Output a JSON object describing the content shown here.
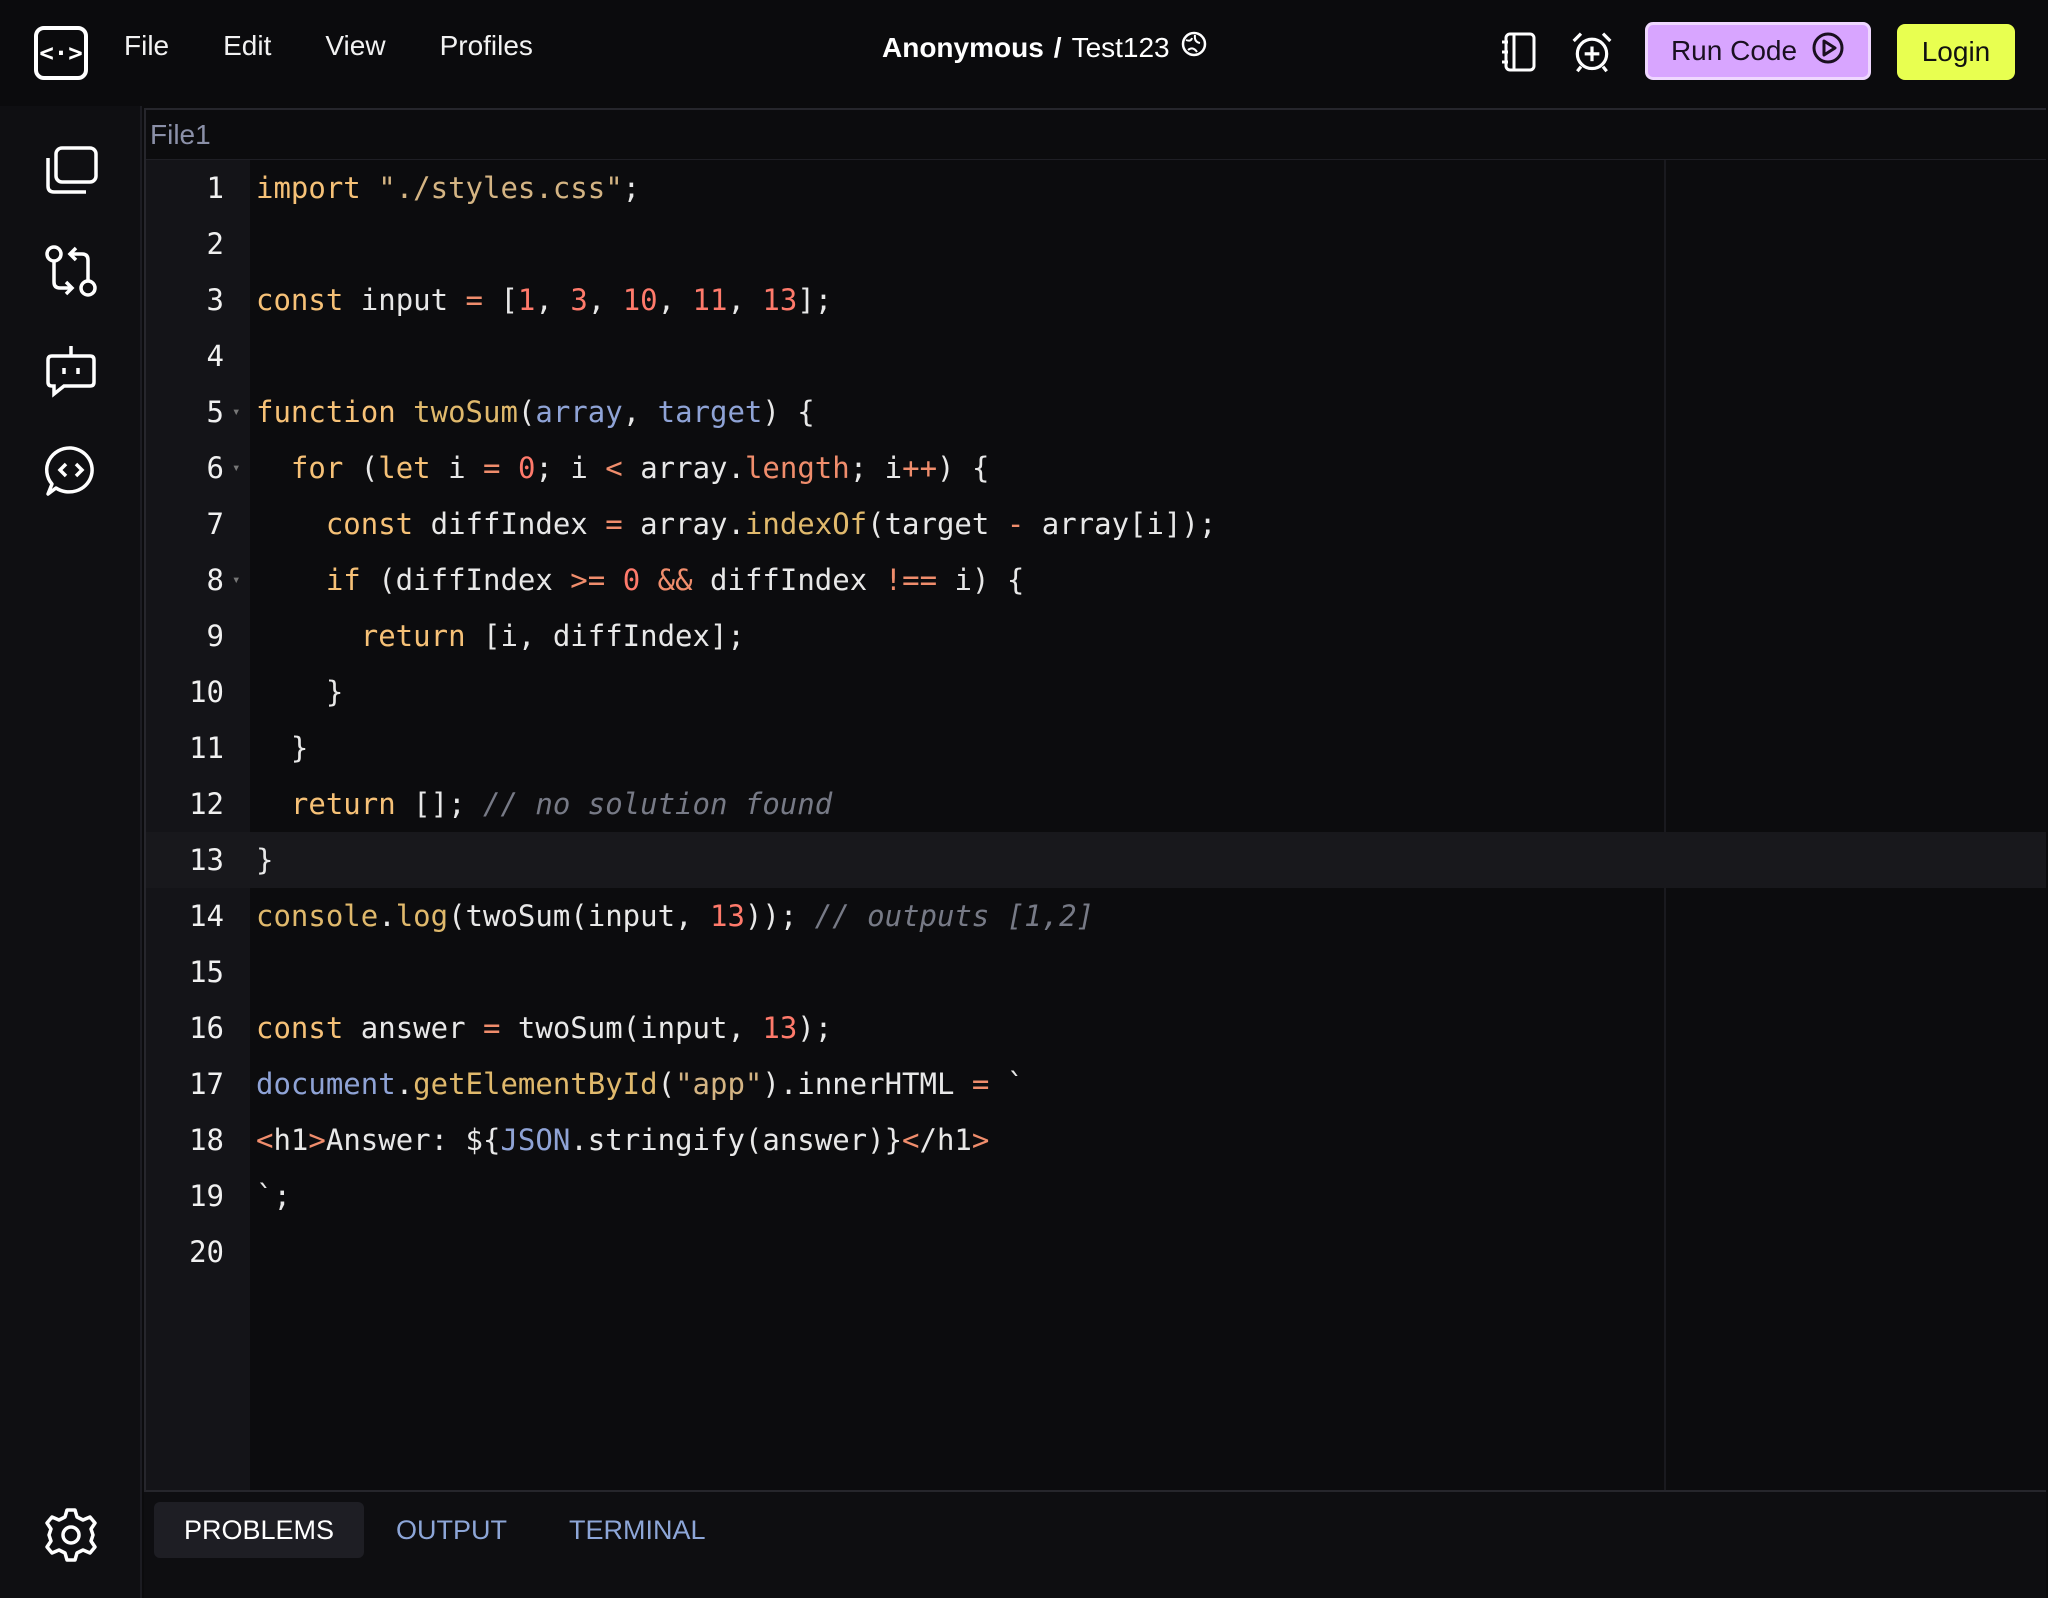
{
  "menu": {
    "logo": "<·>",
    "file": "File",
    "edit": "Edit",
    "view": "View",
    "profiles": "Profiles"
  },
  "project": {
    "owner": "Anonymous",
    "separator": "/",
    "name": "Test123"
  },
  "toolbar": {
    "run_label": "Run Code",
    "login_label": "Login"
  },
  "editor": {
    "file_tab": "File1",
    "current_line": 13,
    "lines": [
      "import \"./styles.css\";",
      "",
      "const input = [1, 3, 10, 11, 13];",
      "",
      "function twoSum(array, target) {",
      "  for (let i = 0; i < array.length; i++) {",
      "    const diffIndex = array.indexOf(target - array[i]);",
      "    if (diffIndex >= 0 && diffIndex !== i) {",
      "      return [i, diffIndex];",
      "    }",
      "  }",
      "  return []; // no solution found",
      "}",
      "console.log(twoSum(input, 13)); // outputs [1,2]",
      "",
      "const answer = twoSum(input, 13);",
      "document.getElementById(\"app\").innerHTML = `",
      "<h1>Answer: ${JSON.stringify(answer)}</h1>",
      "`;",
      ""
    ],
    "line_numbers": [
      "1",
      "2",
      "3",
      "4",
      "5",
      "6",
      "7",
      "8",
      "9",
      "10",
      "11",
      "12",
      "13",
      "14",
      "15",
      "16",
      "17",
      "18",
      "19",
      "20"
    ]
  },
  "panel": {
    "tabs": [
      "PROBLEMS",
      "OUTPUT",
      "TERMINAL"
    ],
    "active_tab": "PROBLEMS"
  },
  "colors": {
    "run_button": "#d8a5ff",
    "login_button": "#e8ff50",
    "background": "#0b0b0d"
  }
}
